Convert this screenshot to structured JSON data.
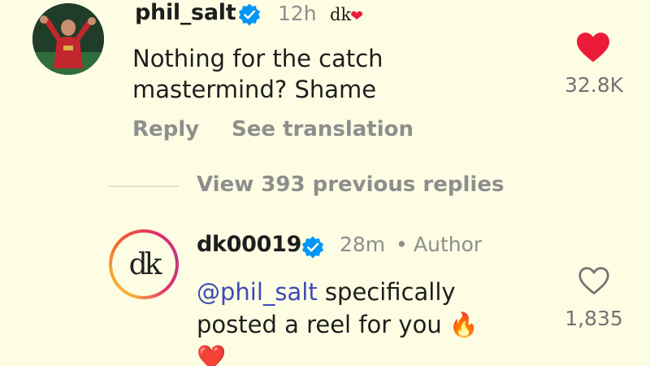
{
  "comments": [
    {
      "username": "phil_salt",
      "time": "12h",
      "liked_by_author_mark": "dk",
      "text": "Nothing for the catch mastermind? Shame",
      "actions": {
        "reply": "Reply",
        "translate": "See translation"
      },
      "like_count": "32.8K",
      "liked": true,
      "verified_icon": "verified-badge",
      "heart_color": "#ed1b3a"
    },
    {
      "username": "dk00019",
      "time": "28m",
      "separator": "•",
      "role": "Author",
      "mention": "@phil_salt",
      "text_line1_rest": " specifically",
      "text_line2": "posted a reel for you 🔥",
      "text_line3": "❤️",
      "like_count": "1,835",
      "liked": false,
      "avatar_mark": "dk"
    }
  ],
  "view_replies": "View 393 previous replies",
  "colors": {
    "background": "#fdfde3",
    "muted": "#8e8e8e",
    "verified": "#0095f6",
    "mention": "#3d4bb8"
  }
}
